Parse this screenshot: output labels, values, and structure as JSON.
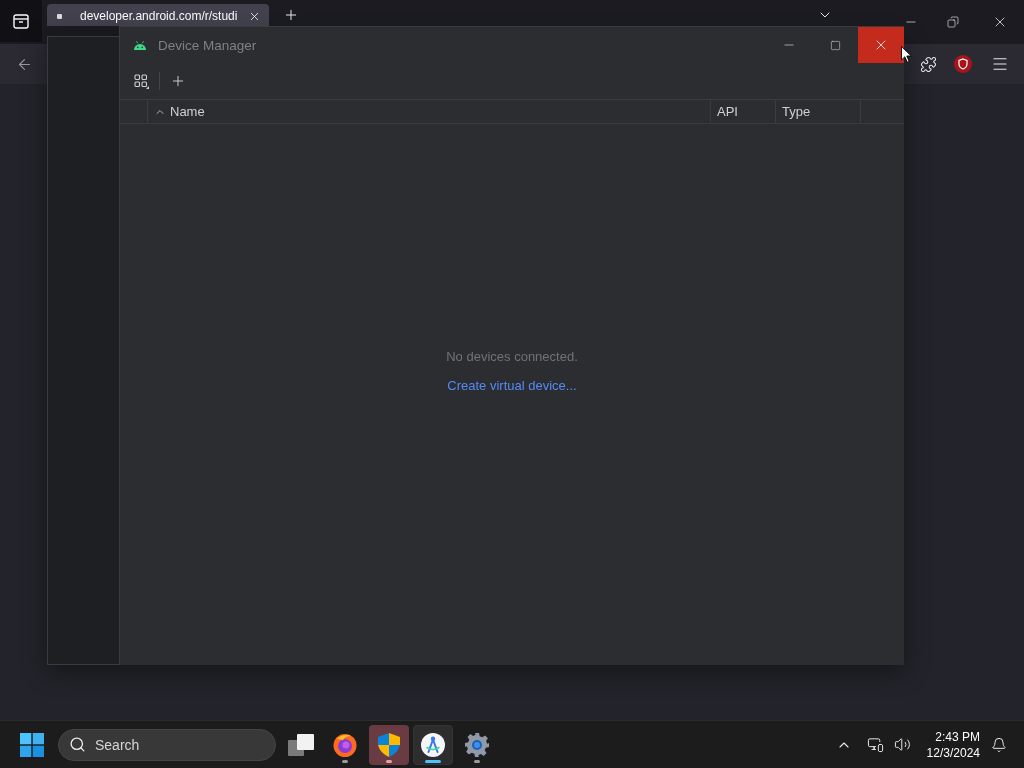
{
  "browser": {
    "tabs": [
      {
        "title": "developer.android.com/r/studi",
        "selected": true
      }
    ]
  },
  "device_manager": {
    "title": "Device Manager",
    "window_controls": [
      {
        "kind": "minimize",
        "hovered": false
      },
      {
        "kind": "maximize",
        "hovered": false
      },
      {
        "kind": "close",
        "hovered": true
      }
    ],
    "columns": [
      {
        "label": "Name",
        "sorted": true
      },
      {
        "label": "API",
        "sorted": false
      },
      {
        "label": "Type",
        "sorted": false
      }
    ],
    "empty_message": "No devices connected.",
    "create_link": "Create virtual device..."
  },
  "taskbar": {
    "search": {
      "placeholder": "Search"
    },
    "apps": [
      {
        "kind": "task-view",
        "running": false,
        "attention": false,
        "selected": false
      },
      {
        "kind": "firefox",
        "running": true,
        "attention": false,
        "selected": false
      },
      {
        "kind": "security",
        "running": true,
        "attention": true,
        "selected": false
      },
      {
        "kind": "android-studio",
        "running": true,
        "attention": false,
        "selected": true
      },
      {
        "kind": "settings",
        "running": true,
        "attention": false,
        "selected": false
      }
    ],
    "clock": {
      "time": "2:43 PM",
      "date": "12/3/2024"
    }
  }
}
